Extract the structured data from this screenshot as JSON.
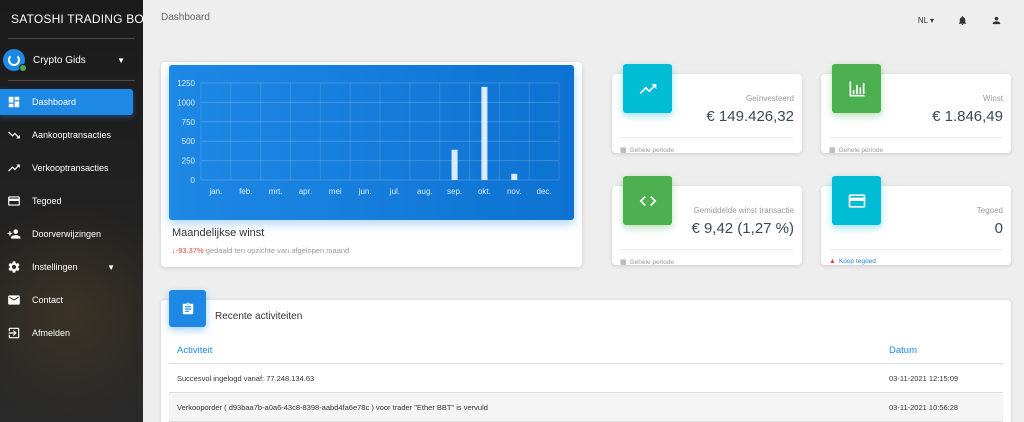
{
  "brand": {
    "title": "SATOSHI TRADING BOT"
  },
  "user": {
    "name": "Crypto Gids"
  },
  "nav": [
    {
      "label": "Dashboard",
      "icon": "dashboard-icon"
    },
    {
      "label": "Aankooptransacties",
      "icon": "trending-down-icon"
    },
    {
      "label": "Verkooptransacties",
      "icon": "trending-up-icon"
    },
    {
      "label": "Tegoed",
      "icon": "credit-card-icon"
    },
    {
      "label": "Doorverwijzingen",
      "icon": "add-user-icon"
    },
    {
      "label": "Instellingen",
      "icon": "gear-icon"
    },
    {
      "label": "Contact",
      "icon": "mail-icon"
    },
    {
      "label": "Afmelden",
      "icon": "logout-icon"
    }
  ],
  "topbar": {
    "title": "Dashboard",
    "language": "NL"
  },
  "chart_card": {
    "title": "Maandelijkse winst",
    "change_pct": "-93.37%",
    "change_text": "gedaald ten opzichte van afgelopen maand"
  },
  "chart_data": {
    "type": "bar",
    "categories": [
      "jan.",
      "feb.",
      "mrt.",
      "apr.",
      "mei",
      "jun.",
      "jul.",
      "aug.",
      "sep.",
      "okt.",
      "nov.",
      "dec."
    ],
    "values": [
      0,
      0,
      0,
      0,
      0,
      0,
      0,
      0,
      390,
      1200,
      80,
      0
    ],
    "ylim": [
      0,
      1250
    ],
    "yticks": [
      0,
      250,
      500,
      750,
      1000,
      1250
    ],
    "grid": true
  },
  "stats": {
    "invested": {
      "label": "Geïnvesteerd",
      "value": "€ 149.426,32",
      "footer": "Gehele periode",
      "color": "#00bcd4",
      "icon": "trending-up-icon"
    },
    "profit": {
      "label": "Winst",
      "value": "€ 1.846,49",
      "footer": "Gehele periode",
      "color": "#4caf50",
      "icon": "bar-chart-icon"
    },
    "avg_profit": {
      "label": "Gemiddelde winst transactie",
      "value": "€ 9,42 (1,27 %)",
      "footer": "Gehele periode",
      "color": "#4caf50",
      "icon": "code-icon"
    },
    "credit": {
      "label": "Tegoed",
      "value": "0",
      "footer": "Koop tegoed",
      "color": "#00bcd4",
      "icon": "credit-card-icon"
    }
  },
  "activity": {
    "title": "Recente activiteiten",
    "columns": [
      "Activiteit",
      "Datum"
    ],
    "rows": [
      {
        "activity": "Succesvol ingelogd vanaf: 77.248.134.63",
        "date": "03-11-2021 12:15:09"
      },
      {
        "activity": "Verkooporder ( d93baa7b-a0a6-43c8-8398-aabd4fa6e78c ) voor trader \"Ether BBT\" is vervuld",
        "date": "03-11-2021 10:56:28"
      }
    ]
  }
}
